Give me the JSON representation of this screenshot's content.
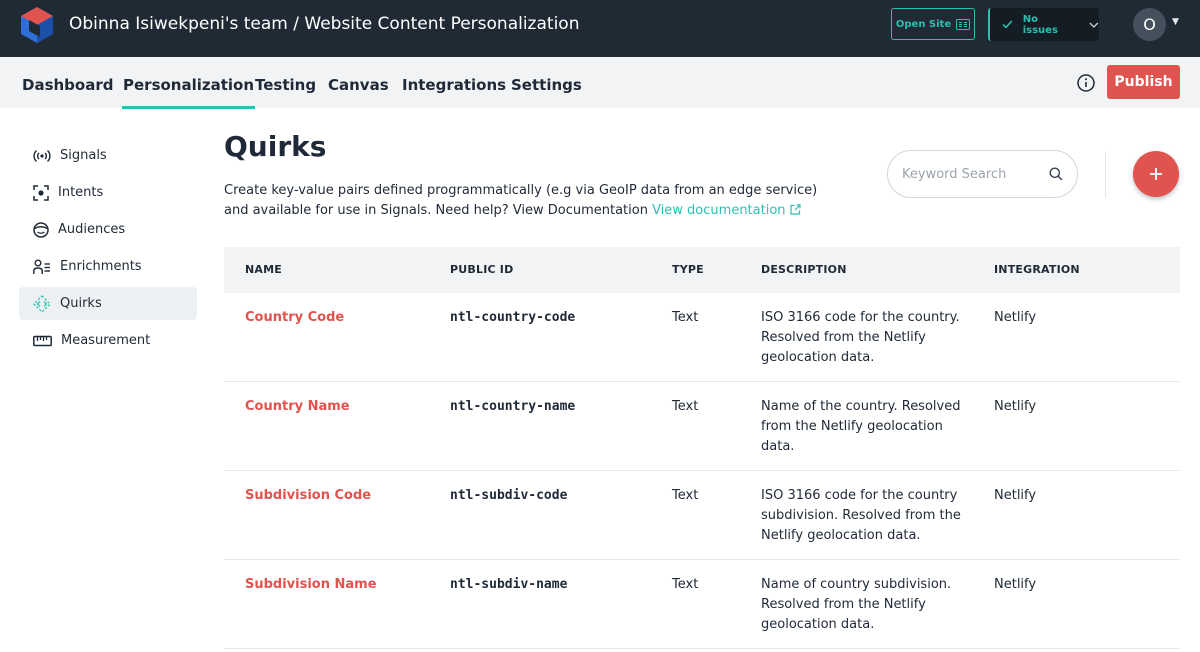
{
  "header": {
    "title": "Obinna Isiwekpeni's team / Website Content Personalization",
    "open_site": "Open Site",
    "status": "No issues",
    "avatar_initial": "O"
  },
  "tabs": [
    {
      "label": "Dashboard",
      "active": false
    },
    {
      "label": "Personalization",
      "active": true
    },
    {
      "label": "Testing",
      "active": false
    },
    {
      "label": "Canvas",
      "active": false
    },
    {
      "label": "Integrations",
      "active": false
    },
    {
      "label": "Settings",
      "active": false
    }
  ],
  "publish_label": "Publish",
  "sidebar": {
    "items": [
      {
        "label": "Signals",
        "icon": "signal-icon",
        "active": false
      },
      {
        "label": "Intents",
        "icon": "target-icon",
        "active": false
      },
      {
        "label": "Audiences",
        "icon": "smile-icon",
        "active": false
      },
      {
        "label": "Enrichments",
        "icon": "user-list-icon",
        "active": false
      },
      {
        "label": "Quirks",
        "icon": "diamond-code-icon",
        "active": true
      },
      {
        "label": "Measurement",
        "icon": "ruler-icon",
        "active": false
      }
    ]
  },
  "page": {
    "title": "Quirks",
    "description": "Create key-value pairs defined programmatically (e.g via GeoIP data from an edge service) and available for use in Signals. Need help? View Documentation ",
    "doc_link": "View documentation",
    "search_placeholder": "Keyword Search"
  },
  "table": {
    "columns": [
      "NAME",
      "PUBLIC ID",
      "TYPE",
      "DESCRIPTION",
      "INTEGRATION"
    ],
    "rows": [
      {
        "name": "Country Code",
        "public_id": "ntl-country-code",
        "type": "Text",
        "description": "ISO 3166 code for the country. Resolved from the Netlify geolocation data.",
        "integration": "Netlify"
      },
      {
        "name": "Country Name",
        "public_id": "ntl-country-name",
        "type": "Text",
        "description": "Name of the country. Resolved from the Netlify geolocation data.",
        "integration": "Netlify"
      },
      {
        "name": "Subdivision Code",
        "public_id": "ntl-subdiv-code",
        "type": "Text",
        "description": "ISO 3166 code for the country subdivision. Resolved from the Netlify geolocation data.",
        "integration": "Netlify"
      },
      {
        "name": "Subdivision Name",
        "public_id": "ntl-subdiv-name",
        "type": "Text",
        "description": "Name of country subdivision. Resolved from the Netlify geolocation data.",
        "integration": "Netlify"
      }
    ]
  },
  "colors": {
    "topbar": "#1f2a35",
    "accent": "#2dbfb0",
    "primary": "#e0534e"
  }
}
